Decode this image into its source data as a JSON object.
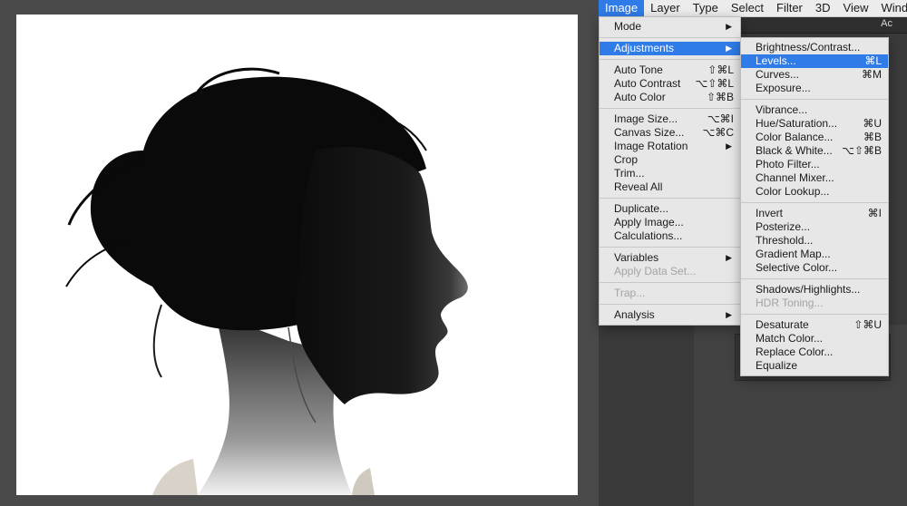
{
  "menubar": {
    "items": [
      {
        "label": "Image",
        "active": true
      },
      {
        "label": "Layer"
      },
      {
        "label": "Type"
      },
      {
        "label": "Select"
      },
      {
        "label": "Filter"
      },
      {
        "label": "3D"
      },
      {
        "label": "View"
      },
      {
        "label": "Windo"
      }
    ]
  },
  "panel": {
    "tab_label": "Ac"
  },
  "image_menu": {
    "mode": {
      "label": "Mode"
    },
    "adjustments": {
      "label": "Adjustments"
    },
    "auto_tone": {
      "label": "Auto Tone",
      "shortcut": "⇧⌘L"
    },
    "auto_contrast": {
      "label": "Auto Contrast",
      "shortcut": "⌥⇧⌘L"
    },
    "auto_color": {
      "label": "Auto Color",
      "shortcut": "⇧⌘B"
    },
    "image_size": {
      "label": "Image Size...",
      "shortcut": "⌥⌘I"
    },
    "canvas_size": {
      "label": "Canvas Size...",
      "shortcut": "⌥⌘C"
    },
    "image_rotation": {
      "label": "Image Rotation"
    },
    "crop": {
      "label": "Crop"
    },
    "trim": {
      "label": "Trim..."
    },
    "reveal_all": {
      "label": "Reveal All"
    },
    "duplicate": {
      "label": "Duplicate..."
    },
    "apply_image": {
      "label": "Apply Image..."
    },
    "calculations": {
      "label": "Calculations..."
    },
    "variables": {
      "label": "Variables"
    },
    "apply_data_set": {
      "label": "Apply Data Set..."
    },
    "trap": {
      "label": "Trap..."
    },
    "analysis": {
      "label": "Analysis"
    }
  },
  "adjustments_menu": {
    "brightness_contrast": {
      "label": "Brightness/Contrast..."
    },
    "levels": {
      "label": "Levels...",
      "shortcut": "⌘L"
    },
    "curves": {
      "label": "Curves...",
      "shortcut": "⌘M"
    },
    "exposure": {
      "label": "Exposure..."
    },
    "vibrance": {
      "label": "Vibrance..."
    },
    "hue_saturation": {
      "label": "Hue/Saturation...",
      "shortcut": "⌘U"
    },
    "color_balance": {
      "label": "Color Balance...",
      "shortcut": "⌘B"
    },
    "black_white": {
      "label": "Black & White...",
      "shortcut": "⌥⇧⌘B"
    },
    "photo_filter": {
      "label": "Photo Filter..."
    },
    "channel_mixer": {
      "label": "Channel Mixer..."
    },
    "color_lookup": {
      "label": "Color Lookup..."
    },
    "invert": {
      "label": "Invert",
      "shortcut": "⌘I"
    },
    "posterize": {
      "label": "Posterize..."
    },
    "threshold": {
      "label": "Threshold..."
    },
    "gradient_map": {
      "label": "Gradient Map..."
    },
    "selective_color": {
      "label": "Selective Color..."
    },
    "shadows_highlights": {
      "label": "Shadows/Highlights..."
    },
    "hdr_toning": {
      "label": "HDR Toning..."
    },
    "desaturate": {
      "label": "Desaturate",
      "shortcut": "⇧⌘U"
    },
    "match_color": {
      "label": "Match Color..."
    },
    "replace_color": {
      "label": "Replace Color..."
    },
    "equalize": {
      "label": "Equalize"
    }
  },
  "icons": {
    "submenu_arrow": "▶"
  },
  "colors": {
    "highlight": "#2f7be8",
    "menu_bg": "#ececec",
    "workspace_bg": "#4a4a4a",
    "disabled_text": "#a3a3a3"
  }
}
